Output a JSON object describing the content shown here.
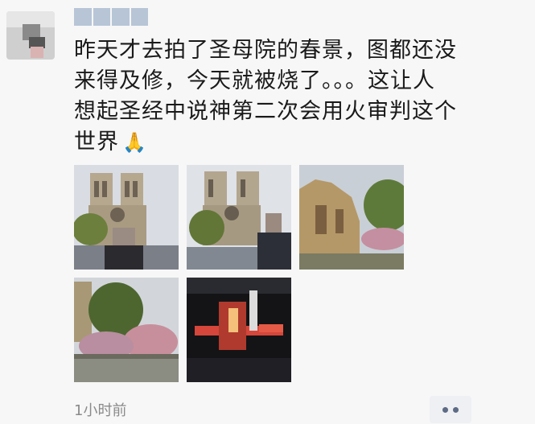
{
  "post": {
    "lines": [
      "昨天才去拍了圣母院的春景，图都还没",
      "来得及修，今天就被烧了。。。这让人",
      "想起圣经中说神第二次会用火审判这个",
      "世界"
    ],
    "emoji": "🙏",
    "timestamp": "1小时前"
  },
  "photos": [
    {
      "icon": "notre-dame-facade-photo"
    },
    {
      "icon": "notre-dame-facade-person-photo"
    },
    {
      "icon": "notre-dame-side-photo"
    },
    {
      "icon": "spring-blossom-photo"
    },
    {
      "icon": "fire-night-photo"
    }
  ],
  "colors": {
    "text": "#1a1a1a",
    "timestamp": "#8a8a8a",
    "nickname_blur": "#b7c5d7",
    "more_dots": "#5d6b86"
  }
}
